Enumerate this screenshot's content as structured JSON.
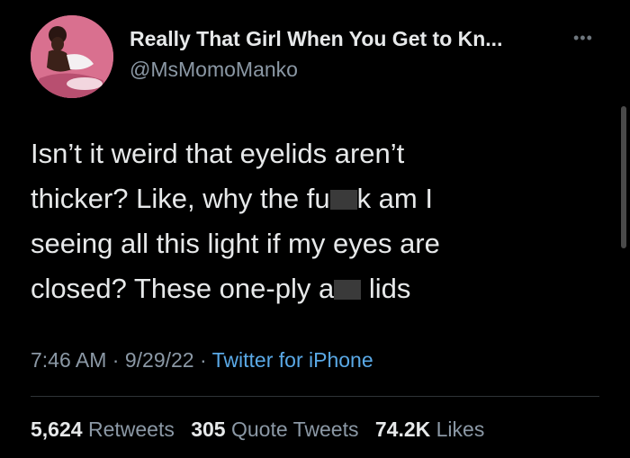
{
  "tweet": {
    "display_name": "Really That Girl When You Get to Kn...",
    "handle": "@MsMomoManko",
    "more_icon": "more-horizontal-icon",
    "text_lines": [
      [
        "Isn’t it weird that eyelids aren’t"
      ],
      [
        "thicker? Like, why the fu",
        "k am I"
      ],
      [
        "seeing all this light if my eyes are"
      ],
      [
        "closed? These one-ply a",
        " lids"
      ]
    ],
    "time": "7:46 AM",
    "date": "9/29/22",
    "separator": "·",
    "source": "Twitter for iPhone",
    "retweets_count": "5,624",
    "retweets_label": "Retweets",
    "quote_count": "305",
    "quote_label": "Quote Tweets",
    "likes_count": "74.2K",
    "likes_label": "Likes"
  },
  "colors": {
    "background": "#000000",
    "text_primary": "#e7e9ea",
    "text_secondary": "#8b98a5",
    "link": "#5aa9e6",
    "divider": "#2f3336"
  }
}
